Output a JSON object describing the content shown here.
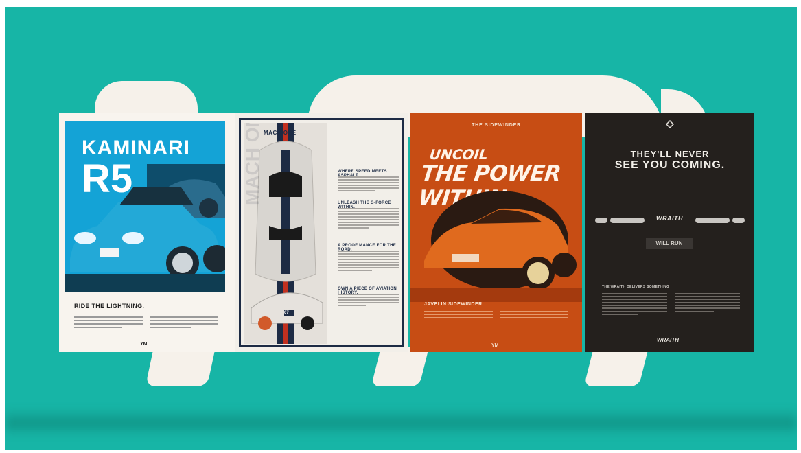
{
  "colors": {
    "background": "#17b5a6",
    "poster_cream": "#f6f1ea",
    "kaminari_blue": "#14a3d6",
    "mach_navy": "#1d2b44",
    "sidewinder_orange": "#c74d14",
    "wraith_dark": "#24201d"
  },
  "posters": [
    {
      "title_line1": "KAMINARI",
      "title_line2": "R5",
      "subhead": "RIDE THE LIGHTNING.",
      "footer_logo": "YM"
    },
    {
      "brand": "MACH ONE",
      "vertical_text": "MACH ONE",
      "car_number": "07",
      "sections": [
        "WHERE SPEED MEETS ASPHALT.",
        "UNLEASH THE G-FORCE WITHIN.",
        "A PROOF MANCE FOR THE ROAD.",
        "OWN A PIECE OF AVIATION HISTORY."
      ]
    },
    {
      "top_label": "THE SIDEWINDER",
      "headline_line1": "UNCOIL",
      "headline_line2": "THE POWER WITHIN.",
      "model_name": "JAVELIN SIDEWINDER",
      "footer_logo": "YM"
    },
    {
      "headline_line1": "THEY'LL NEVER",
      "headline_line2": "SEE YOU COMING.",
      "logo": "WRAITH",
      "button_label": "WILL RUN",
      "subhead": "THE WRAITH DELIVERS SOMETHING"
    }
  ]
}
